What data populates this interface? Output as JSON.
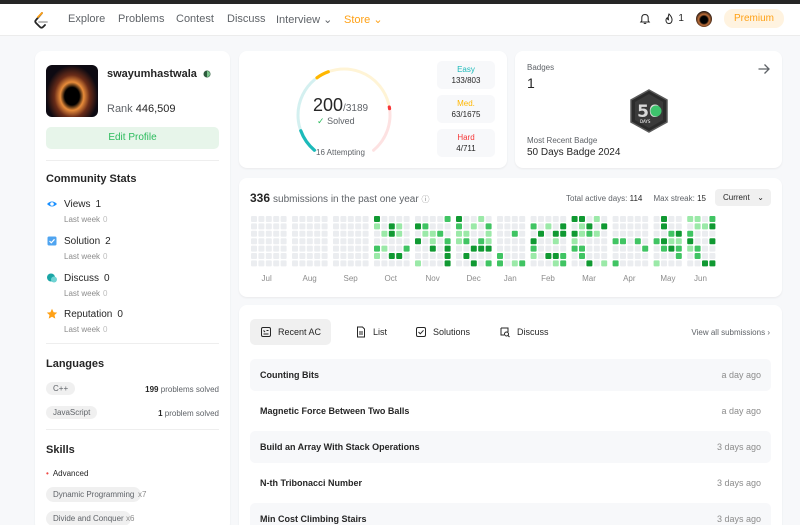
{
  "nav": {
    "items": [
      "Explore",
      "Problems",
      "Contest",
      "Discuss",
      "Interview",
      "Store"
    ],
    "streak": "1",
    "premium": "Premium"
  },
  "profile": {
    "username": "swayumhastwala",
    "rank_label": "Rank",
    "rank_value": "446,509",
    "edit": "Edit Profile"
  },
  "community": {
    "title": "Community Stats",
    "stats": [
      {
        "label": "Views",
        "value": "1",
        "lastweek": "Last week",
        "lw_value": "0"
      },
      {
        "label": "Solution",
        "value": "2",
        "lastweek": "Last week",
        "lw_value": "0"
      },
      {
        "label": "Discuss",
        "value": "0",
        "lastweek": "Last week",
        "lw_value": "0"
      },
      {
        "label": "Reputation",
        "value": "0",
        "lastweek": "Last week",
        "lw_value": "0"
      }
    ]
  },
  "languages": {
    "title": "Languages",
    "items": [
      {
        "name": "C++",
        "count": "199",
        "suffix": "problems solved"
      },
      {
        "name": "JavaScript",
        "count": "1",
        "suffix": "problem solved"
      }
    ]
  },
  "skills": {
    "title": "Skills",
    "level": "Advanced",
    "items": [
      {
        "name": "Dynamic Programming",
        "count": "x7"
      },
      {
        "name": "Divide and Conquer",
        "count": "x6"
      }
    ]
  },
  "progress": {
    "solved": "200",
    "total": "/3189",
    "solved_label": "Solved",
    "attempting": "16 Attempting",
    "easy": {
      "label": "Easy",
      "count": "133/803",
      "color": "#1cbaba"
    },
    "medium": {
      "label": "Med.",
      "count": "63/1675",
      "color": "#ffb700"
    },
    "hard": {
      "label": "Hard",
      "count": "4/711",
      "color": "#f63737"
    }
  },
  "badges": {
    "title": "Badges",
    "count": "1",
    "recent_label": "Most Recent Badge",
    "recent_name": "50 Days Badge 2024",
    "badge_text": "50",
    "badge_sub": "DAYS"
  },
  "heatmap": {
    "count": "336",
    "label": "submissions in the past one year",
    "active_label": "Total active days:",
    "active_value": "114",
    "streak_label": "Max streak:",
    "streak_value": "15",
    "current": "Current",
    "months": [
      "Jul",
      "Aug",
      "Sep",
      "Oct",
      "Nov",
      "Dec",
      "Jan",
      "Feb",
      "Mar",
      "Apr",
      "May",
      "Jun"
    ]
  },
  "submissions": {
    "tabs": [
      "Recent AC",
      "List",
      "Solutions",
      "Discuss"
    ],
    "view_all": "View all submissions",
    "rows": [
      {
        "title": "Counting Bits",
        "time": "a day ago"
      },
      {
        "title": "Magnetic Force Between Two Balls",
        "time": "a day ago"
      },
      {
        "title": "Build an Array With Stack Operations",
        "time": "3 days ago"
      },
      {
        "title": "N-th Tribonacci Number",
        "time": "3 days ago"
      },
      {
        "title": "Min Cost Climbing Stairs",
        "time": "3 days ago"
      }
    ]
  }
}
